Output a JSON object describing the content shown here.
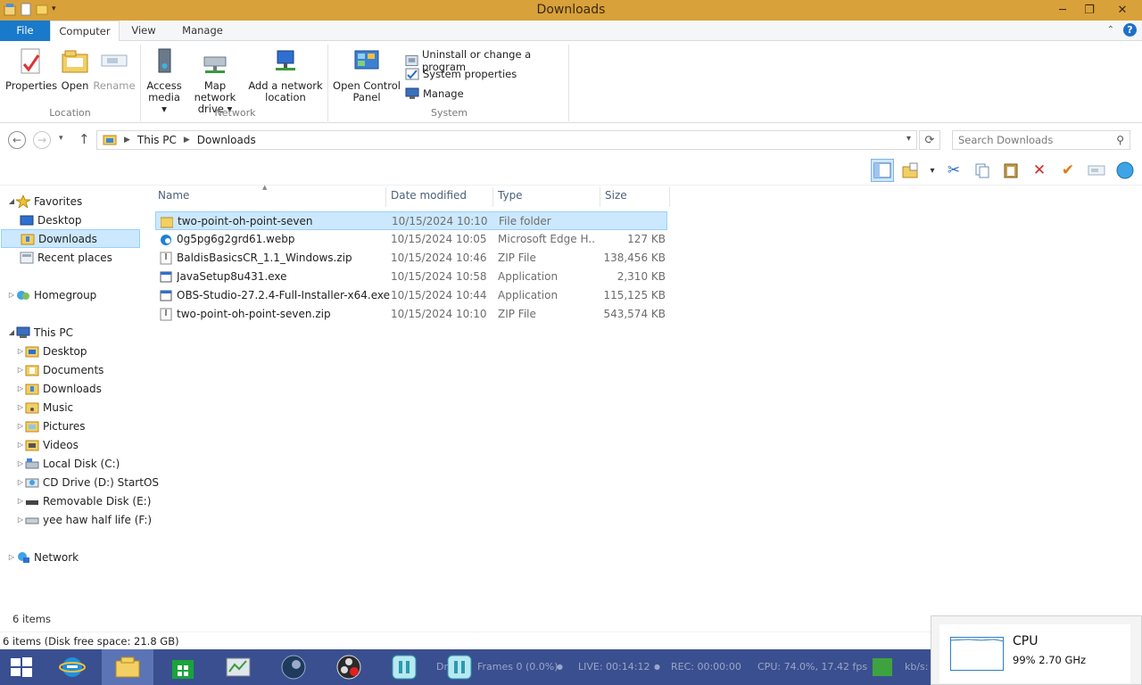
{
  "window": {
    "title": "Downloads"
  },
  "ribbon": {
    "tabs": {
      "file": "File",
      "computer": "Computer",
      "view": "View",
      "manage": "Manage"
    },
    "location": {
      "label": "Location",
      "properties": "Properties",
      "open": "Open",
      "rename": "Rename"
    },
    "network": {
      "label": "Network",
      "access_media_1": "Access",
      "access_media_2": "media ▾",
      "map_drive_1": "Map network",
      "map_drive_2": "drive ▾",
      "add_location_1": "Add a network",
      "add_location_2": "location"
    },
    "system": {
      "label": "System",
      "open_cp_1": "Open Control",
      "open_cp_2": "Panel",
      "uninstall": "Uninstall or change a program",
      "sys_props": "System properties",
      "manage": "Manage"
    }
  },
  "address": {
    "crumbs": [
      "This PC",
      "Downloads"
    ],
    "search_placeholder": "Search Downloads"
  },
  "nav": {
    "favorites": "Favorites",
    "desktop": "Desktop",
    "downloads": "Downloads",
    "recent": "Recent places",
    "homegroup": "Homegroup",
    "thispc": "This PC",
    "pc_desktop": "Desktop",
    "documents": "Documents",
    "pc_downloads": "Downloads",
    "music": "Music",
    "pictures": "Pictures",
    "videos": "Videos",
    "local_disk": "Local Disk (C:)",
    "cd_drive": "CD Drive (D:) StartOS",
    "removable": "Removable Disk (E:)",
    "yeehaw": "yee haw half life (F:)",
    "network": "Network"
  },
  "columns": {
    "name": "Name",
    "date": "Date modified",
    "type": "Type",
    "size": "Size"
  },
  "files": [
    {
      "name": "two-point-oh-point-seven",
      "date": "10/15/2024 10:10 ...",
      "type": "File folder",
      "size": ""
    },
    {
      "name": "0g5pg6g2grd61.webp",
      "date": "10/15/2024 10:05 ...",
      "type": "Microsoft Edge H...",
      "size": "127 KB"
    },
    {
      "name": "BaldisBasicsCR_1.1_Windows.zip",
      "date": "10/15/2024 10:46 ...",
      "type": "ZIP File",
      "size": "138,456 KB"
    },
    {
      "name": "JavaSetup8u431.exe",
      "date": "10/15/2024 10:58 ...",
      "type": "Application",
      "size": "2,310 KB"
    },
    {
      "name": "OBS-Studio-27.2.4-Full-Installer-x64.exe",
      "date": "10/15/2024 10:44 ...",
      "type": "Application",
      "size": "115,125 KB"
    },
    {
      "name": "two-point-oh-point-seven.zip",
      "date": "10/15/2024 10:10 ...",
      "type": "ZIP File",
      "size": "543,574 KB"
    }
  ],
  "status": {
    "items": "6 items",
    "disk": "6 items (Disk free space: 21.8 GB)"
  },
  "taskbar": {
    "obs_dropped": "Dr",
    "obs_frames": "Frames 0 (0.0%)",
    "obs_live": "LIVE: 00:14:12",
    "obs_rec": "REC: 00:00:00",
    "obs_cpu": "CPU: 74.0%, 17.42 fps",
    "obs_kbs": "kb/s:"
  },
  "cpu_popup": {
    "label": "CPU",
    "value": "99%  2.70 GHz"
  },
  "colors": {
    "titlebar": "#d9a13a",
    "file_tab": "#1979ca",
    "taskbar": "#3a4f8f",
    "selection": "#cce8ff"
  }
}
